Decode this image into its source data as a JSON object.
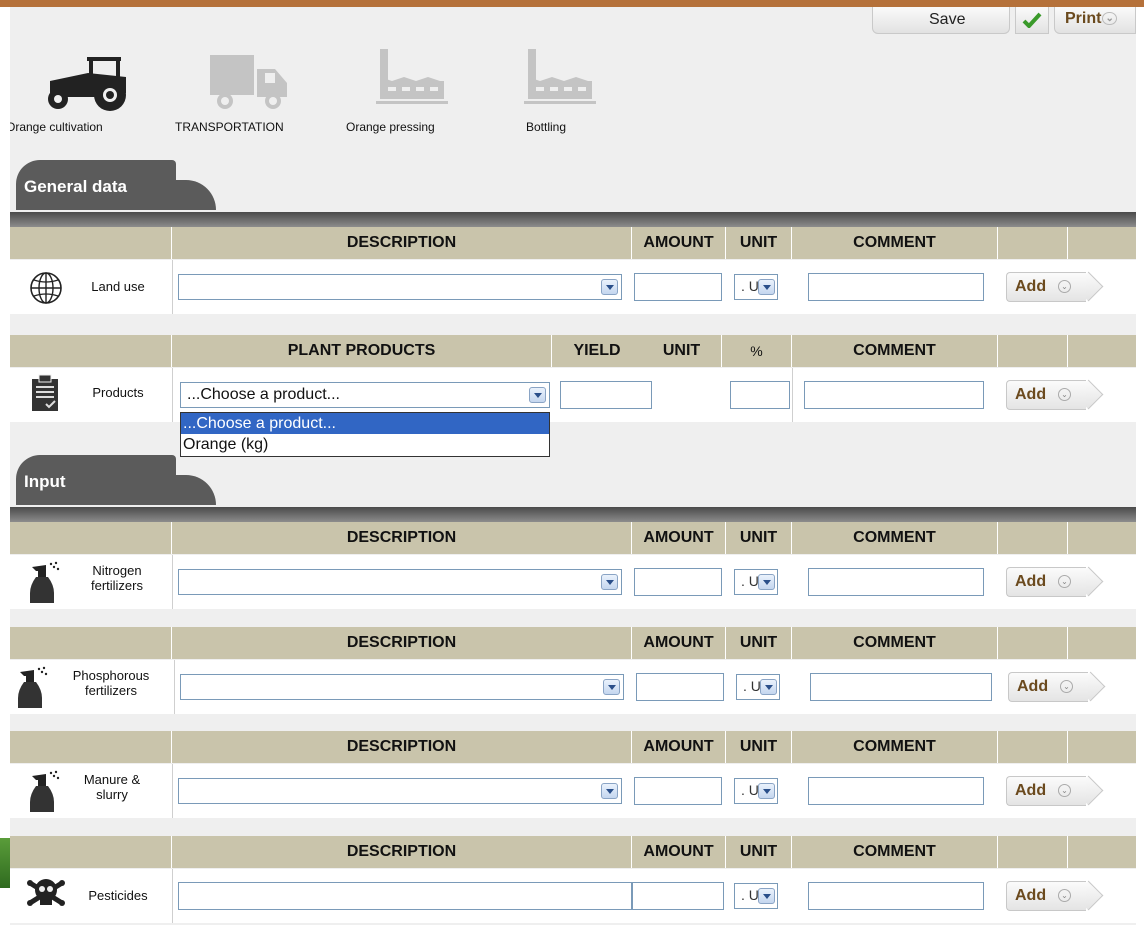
{
  "toolbar": {
    "save_label": "Save",
    "print_label": "Print"
  },
  "stages": [
    {
      "label": "Orange cultivation",
      "icon": "tractor-icon",
      "active": true
    },
    {
      "label": "TRANSPORTATION",
      "icon": "truck-icon",
      "active": false
    },
    {
      "label": "Orange pressing",
      "icon": "factory-icon",
      "active": false
    },
    {
      "label": "Bottling",
      "icon": "factory-icon",
      "active": false
    }
  ],
  "sections": {
    "general": {
      "title": "General data"
    },
    "input": {
      "title": "Input"
    }
  },
  "headers": {
    "standard": {
      "description": "DESCRIPTION",
      "amount": "AMOUNT",
      "unit": "UNIT",
      "comment": "COMMENT"
    },
    "products": {
      "plant_products": "PLANT PRODUCTS",
      "yield": "YIELD",
      "unit": "UNIT",
      "percent": "%",
      "comment": "COMMENT"
    }
  },
  "rows": {
    "land_use": {
      "label": "Land use",
      "unit_value": ". U"
    },
    "products": {
      "label": "Products",
      "select_value": "...Choose a product..."
    },
    "nitrogen": {
      "label_line1": "Nitrogen",
      "label_line2": "fertilizers",
      "unit_value": ". U"
    },
    "phosphorous": {
      "label_line1": "Phosphorous",
      "label_line2": "fertilizers",
      "unit_value": ". U"
    },
    "manure": {
      "label_line1": "Manure &",
      "label_line2": "slurry",
      "unit_value": ". U"
    },
    "pesticides": {
      "label": "Pesticides",
      "unit_value": ". U"
    }
  },
  "add_label": "Add",
  "product_dropdown": {
    "options": [
      "...Choose a product...",
      "Orange (kg)"
    ],
    "highlighted": "...Choose a product..."
  },
  "colors": {
    "header_bg": "#c9c4ab",
    "tab_bg": "#5b5b5b",
    "top_bar": "#b5713a",
    "add_text": "#6b4a1e",
    "dropdown_highlight": "#3166c4"
  }
}
